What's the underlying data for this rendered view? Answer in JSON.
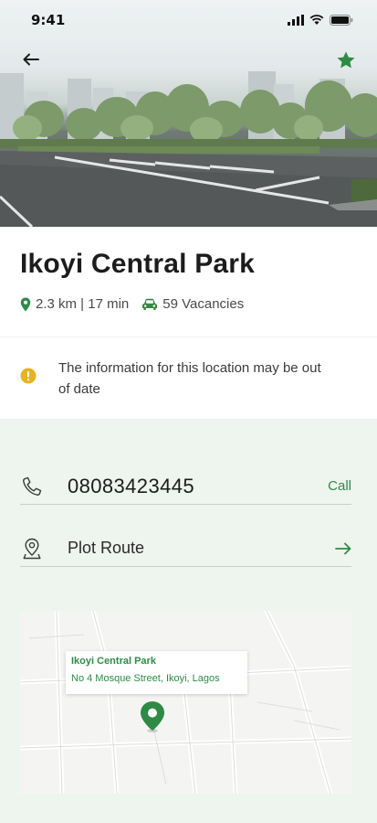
{
  "status_bar": {
    "time": "9:41"
  },
  "hero": {
    "image": "parking-lot-photo"
  },
  "header": {
    "back_icon": "arrow-left-icon",
    "favorite_icon": "star-icon"
  },
  "park": {
    "name": "Ikoyi Central Park",
    "distance_time": "2.3 km | 17 min",
    "vacancies": "59 Vacancies"
  },
  "notice": {
    "text": "The information for this location may be out of date"
  },
  "contact": {
    "phone": "08083423445",
    "call_label": "Call",
    "route_label": "Plot Route"
  },
  "map": {
    "card_title": "Ikoyi Central Park",
    "card_address": "No 4 Mosque Street, Ikoyi, Lagos"
  },
  "colors": {
    "accent": "#2e8b46",
    "warning": "#e6b422",
    "background": "#eef4ee"
  }
}
